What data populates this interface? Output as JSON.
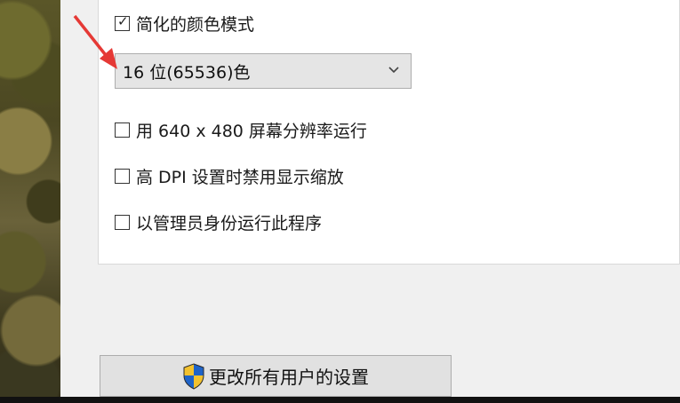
{
  "options": {
    "reduced_color_label": "简化的颜色模式",
    "reduced_color_checked": true,
    "color_depth_selected": "16 位(65536)色",
    "run_640_label": "用 640 x 480 屏幕分辨率运行",
    "run_640_checked": false,
    "disable_dpi_label": "高 DPI 设置时禁用显示缩放",
    "disable_dpi_checked": false,
    "run_as_admin_label": "以管理员身份运行此程序",
    "run_as_admin_checked": false
  },
  "footer": {
    "change_all_users_label": "更改所有用户的设置"
  },
  "icons": {
    "check": "check-icon",
    "dropdown": "chevron-down-icon",
    "shield": "shield-icon",
    "annotation": "arrow-annotation-icon"
  },
  "colors": {
    "annotation_red": "#e53935",
    "shield_blue": "#1e63c8",
    "shield_yellow": "#f2c12e"
  }
}
